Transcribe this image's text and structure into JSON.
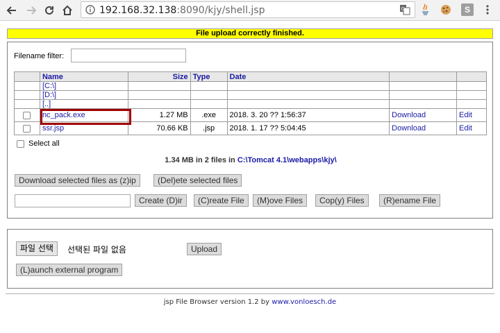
{
  "browser": {
    "url_host": "192.168.32.138",
    "url_rest": ":8090/kjy/shell.jsp",
    "ext_s_label": "S"
  },
  "banner": {
    "text": "File upload correctly finished."
  },
  "filter": {
    "label": "Filename filter:",
    "value": ""
  },
  "table": {
    "headers": {
      "name": "Name",
      "size": "Size",
      "type": "Type",
      "date": "Date"
    },
    "dirs": [
      "[C:\\]",
      "[D:\\]",
      "[..]"
    ],
    "files": [
      {
        "name": "nc_pack.exe",
        "size": "1.27 MB",
        "type": ".exe",
        "date": "2018. 3. 20 ?? 1:56:37",
        "download": "Download",
        "edit": "Edit"
      },
      {
        "name": "ssr.jsp",
        "size": "70.66 KB",
        "type": ".jsp",
        "date": "2018. 1. 17 ?? 5:04:45",
        "download": "Download",
        "edit": "Edit"
      }
    ]
  },
  "select_all": "Select all",
  "summary": {
    "prefix": "1.34 MB in 2 files in ",
    "path": "C:\\Tomcat 4.1\\webapps\\kjy\\"
  },
  "buttons": {
    "download_zip": "Download selected files as (z)ip",
    "delete": "(Del)ete selected files",
    "create_dir": "Create (D)ir",
    "create_file": "(C)reate File",
    "move": "(M)ove Files",
    "copy": "Cop(y) Files",
    "rename": "(R)ename File",
    "choose_file": "파일 선택",
    "no_file": "선택된 파일 없음",
    "upload": "Upload",
    "launch": "(L)aunch external program"
  },
  "footer": {
    "prefix": "jsp File Browser version 1.2 by ",
    "link": "www.vonloesch.de"
  },
  "colors": {
    "banner": "#ffff00",
    "link": "#1a1aa6",
    "highlight": "#a10000"
  }
}
